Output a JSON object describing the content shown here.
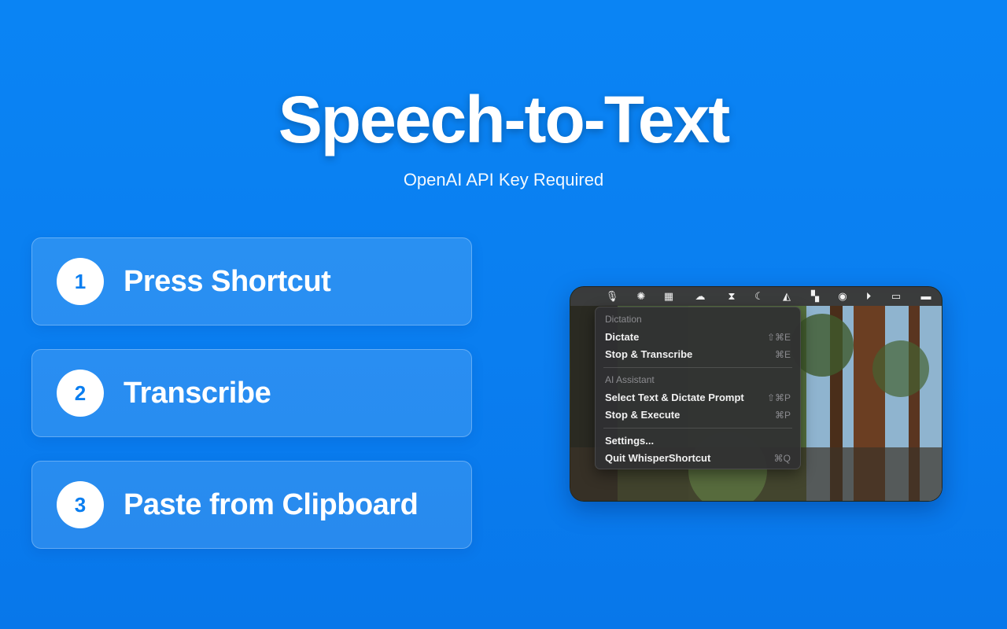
{
  "hero": {
    "title": "Speech-to-Text",
    "subtitle": "OpenAI API Key Required"
  },
  "steps": [
    {
      "number": "1",
      "label": "Press Shortcut"
    },
    {
      "number": "2",
      "label": "Transcribe"
    },
    {
      "number": "3",
      "label": "Paste from Clipboard"
    }
  ],
  "menubar_icons": [
    "microphone-icon",
    "openai-icon",
    "teams-icon",
    "cloud-icon",
    "hourglass-icon",
    "moon-icon",
    "triangle-icon",
    "layout-icon",
    "user-icon",
    "play-icon",
    "keyboard-icon",
    "battery-icon"
  ],
  "menu": {
    "dictation_header": "Dictation",
    "dictate_label": "Dictate",
    "dictate_shortcut": "⇧⌘E",
    "stop_transcribe_label": "Stop & Transcribe",
    "stop_transcribe_shortcut": "⌘E",
    "assistant_header": "AI Assistant",
    "select_dictate_label": "Select Text & Dictate Prompt",
    "select_dictate_shortcut": "⇧⌘P",
    "stop_execute_label": "Stop & Execute",
    "stop_execute_shortcut": "⌘P",
    "settings_label": "Settings...",
    "quit_label": "Quit WhisperShortcut",
    "quit_shortcut": "⌘Q"
  },
  "colors": {
    "background": "#0a7ef0",
    "accent_number": "#0a7ef0"
  }
}
